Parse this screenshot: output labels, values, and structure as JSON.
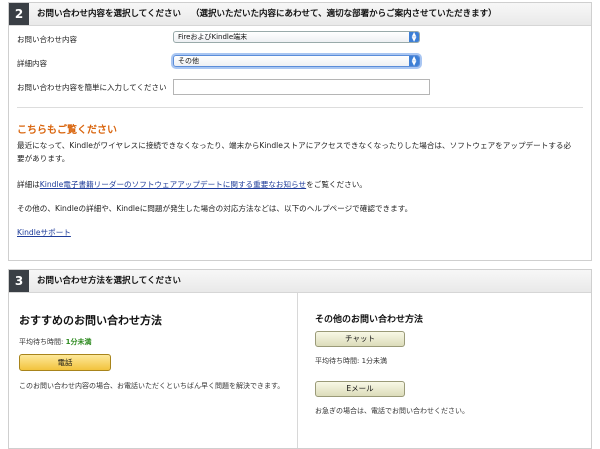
{
  "step2": {
    "number": "2",
    "title": "お問い合わせ内容を選択してください",
    "note": "（選択いただいた内容にあわせて、適切な部署からご案内させていただきます）",
    "inquiry_label": "お問い合わせ内容",
    "inquiry_value": "FireおよびKindle端末",
    "detail_label": "詳細内容",
    "detail_value": "その他",
    "text_label": "お問い合わせ内容を簡単に入力してください",
    "text_value": "",
    "see_also_heading": "こちらもご覧ください",
    "para1": "最近になって、Kindleがワイヤレスに接続できなくなったり、端末からKindleストアにアクセスできなくなったりした場合は、ソフトウェアをアップデートする必要があります。",
    "para2_prefix": "詳細は",
    "para2_link": "Kindle電子書籍リーダーのソフトウェアアップデートに関する重要なお知らせ",
    "para2_suffix": "をご覧ください。",
    "para3": "その他の、Kindleの詳細や、Kindleに問題が発生した場合の対応方法などは、以下のヘルプページで確認できます。",
    "support_link": "Kindleサポート"
  },
  "step3": {
    "number": "3",
    "title": "お問い合わせ方法を選択してください",
    "recommended_title": "おすすめのお問い合わせ方法",
    "wait_label": "平均待ち時間:",
    "wait_value": "1分未満",
    "phone_button": "電話",
    "phone_note": "このお問い合わせ内容の場合、お電話いただくといちばん早く問題を解決できます。",
    "other_title": "その他のお問い合わせ方法",
    "chat_button": "チャット",
    "chat_wait": "平均待ち時間: 1分未満",
    "email_button": "Eメール",
    "email_note": "お急ぎの場合は、電話でお問い合わせください。"
  }
}
